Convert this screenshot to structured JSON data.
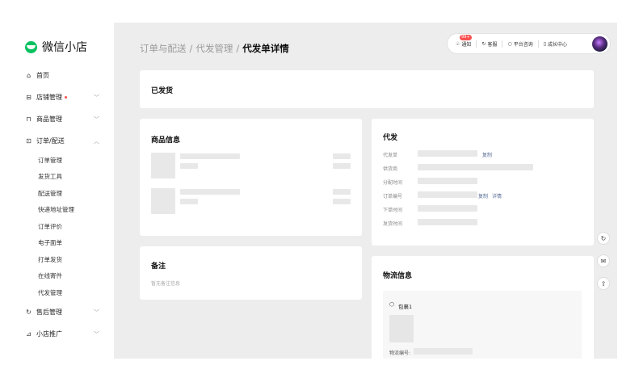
{
  "sidebar": {
    "logo_text": "微信小店",
    "items": [
      {
        "label": "首页",
        "icon": "home-icon"
      },
      {
        "label": "店铺管理",
        "icon": "store-icon",
        "dot": true
      },
      {
        "label": "商品管理",
        "icon": "bag-icon"
      },
      {
        "label": "订单/配送",
        "icon": "order-icon",
        "expanded": true
      }
    ],
    "subitems": [
      "订单管理",
      "发货工具",
      "配送管理",
      "快递地址管理",
      "订单评价",
      "电子面单",
      "打单发货",
      "在线寄件",
      "代发管理"
    ],
    "bottom_items": [
      {
        "label": "售后管理",
        "icon": "aftersale-icon"
      },
      {
        "label": "小店推广",
        "icon": "promotion-icon"
      }
    ]
  },
  "breadcrumb": {
    "level1": "订单与配送",
    "sep1": "/",
    "level2": "代发管理",
    "sep2": "/",
    "current": "代发单详情"
  },
  "topbar": {
    "notice": "通知",
    "badge": "99+",
    "service": "客服",
    "consult": "平台咨询",
    "growth": "成长中心"
  },
  "status_card": {
    "status": "已发货"
  },
  "goods_card": {
    "title": "商品信息"
  },
  "remark_card": {
    "title": "备注",
    "empty_text": "暂无备注信息"
  },
  "dropship_card": {
    "title": "代发",
    "fields": [
      "代发单",
      "供货商",
      "分配时间",
      "订单编号",
      "下单时间",
      "发货时间"
    ],
    "copy_link": "复制",
    "copy_link2": "复制",
    "detail_link": "详情"
  },
  "logistics_card": {
    "title": "物流信息",
    "package_label": "包裹1",
    "tracking_label": "物流编号:"
  },
  "colors": {
    "accent": "#07c160",
    "link": "#576b95",
    "badge": "#fa5151"
  }
}
